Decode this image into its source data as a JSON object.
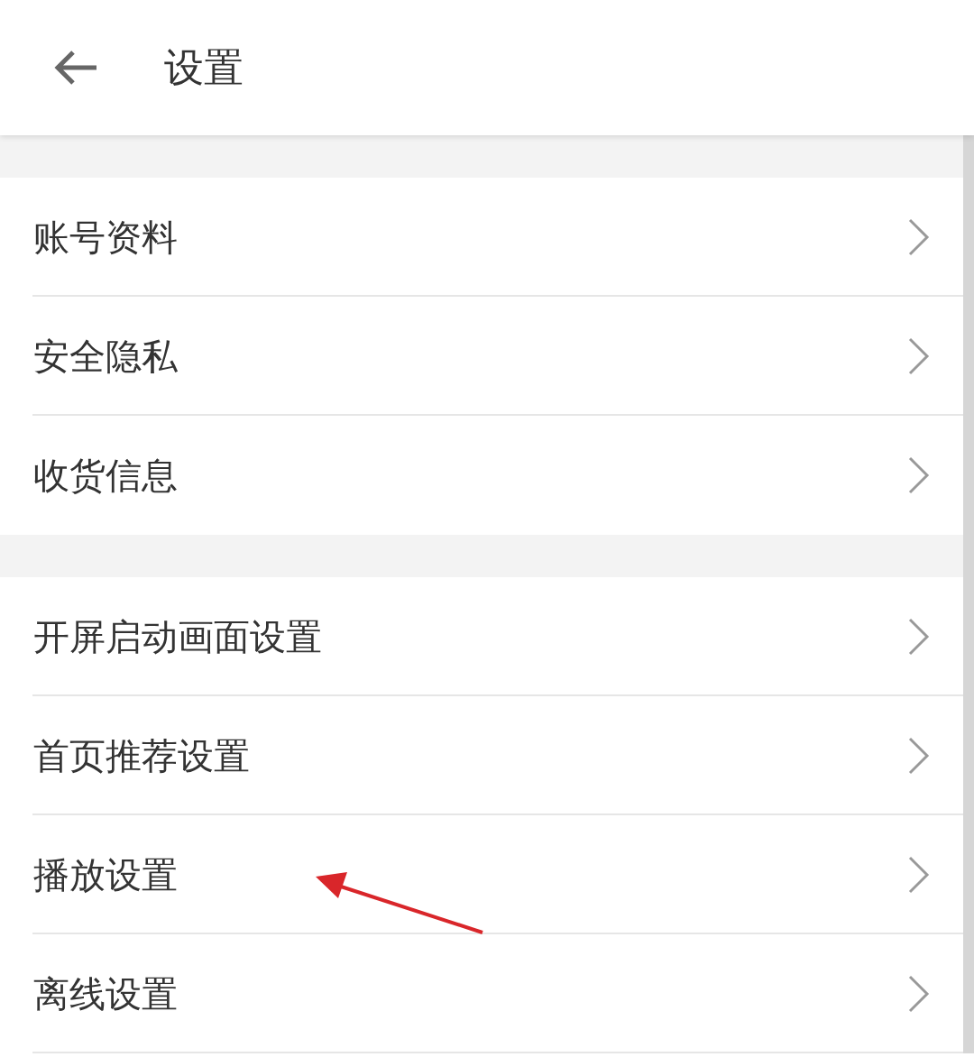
{
  "header": {
    "title": "设置"
  },
  "sections": [
    {
      "items": [
        {
          "label": "账号资料"
        },
        {
          "label": "安全隐私"
        },
        {
          "label": "收货信息"
        }
      ]
    },
    {
      "items": [
        {
          "label": "开屏启动画面设置"
        },
        {
          "label": "首页推荐设置"
        },
        {
          "label": "播放设置"
        },
        {
          "label": "离线设置"
        }
      ]
    }
  ]
}
